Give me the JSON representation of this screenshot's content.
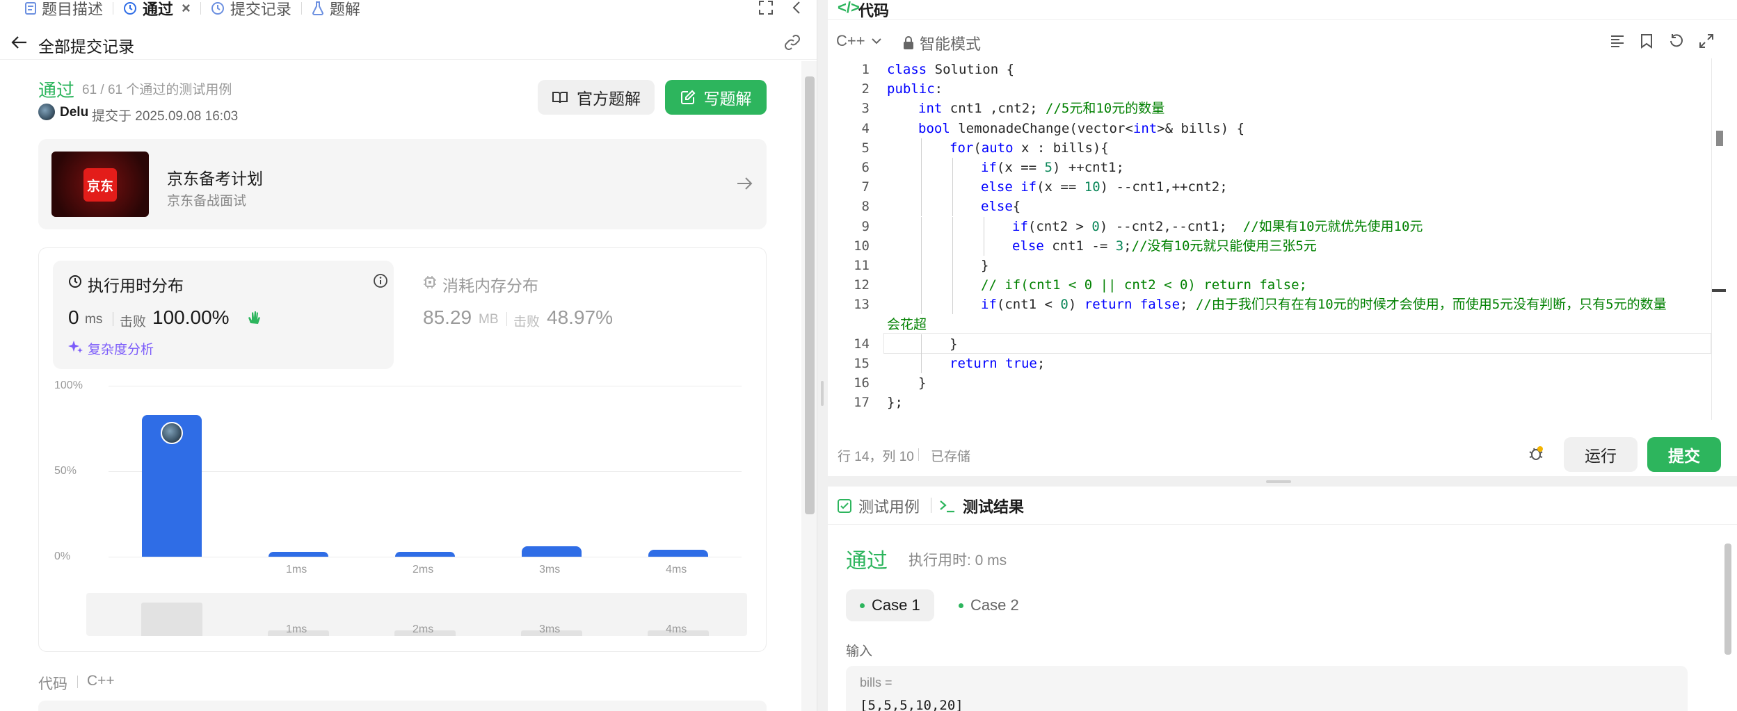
{
  "tabs": [
    {
      "label": "题目描述",
      "icon": "description-icon"
    },
    {
      "label": "通过",
      "icon": "history-icon"
    },
    {
      "label": "提交记录",
      "icon": "history-icon"
    },
    {
      "label": "题解",
      "icon": "flask-icon"
    }
  ],
  "back_label": "全部提交记录",
  "submission": {
    "status": "通过",
    "passed_text": "61 / 61 个通过的测试用例",
    "user": "Delu",
    "submitted_at": "提交于 2025.09.08 16:03",
    "official_solution": "官方题解",
    "write_solution": "写题解"
  },
  "promo": {
    "logo_text": "京东",
    "title": "京东备考计划",
    "subtitle": "京东备战面试"
  },
  "runtime": {
    "title": "执行用时分布",
    "value": "0",
    "unit": "ms",
    "beats_label": "击败",
    "beats": "100.00%",
    "complexity": "复杂度分析"
  },
  "memory": {
    "title": "消耗内存分布",
    "value": "85.29",
    "unit": "MB",
    "beats_label": "击败",
    "beats": "48.97%"
  },
  "chart_data": {
    "type": "bar",
    "categories": [
      "0ms",
      "1ms",
      "2ms",
      "3ms",
      "4ms"
    ],
    "x_tick_labels": [
      "",
      "1ms",
      "2ms",
      "3ms",
      "4ms"
    ],
    "values": [
      83,
      3,
      3,
      6,
      4
    ],
    "ylim": [
      0,
      100
    ],
    "y_ticks": [
      "100%",
      "50%",
      "0%"
    ],
    "grid": true
  },
  "code_section": {
    "label": "代码",
    "lang": "C++"
  },
  "editor": {
    "title": "代码",
    "lang": "C++",
    "mode": "智能模式",
    "lines": [
      {
        "n": "1",
        "indent": 0,
        "html": "<span class='kw'>class</span> Solution {"
      },
      {
        "n": "2",
        "indent": 0,
        "html": "<span class='kw'>public</span>:"
      },
      {
        "n": "3",
        "indent": 1,
        "html": "<span class='ty'>int</span> cnt1 ,cnt2; <span class='cm'>//5元和10元的数量</span>"
      },
      {
        "n": "4",
        "indent": 1,
        "html": "<span class='ty'>bool</span> lemonadeChange(vector&lt;<span class='ty'>int</span>&gt;&amp; bills) {"
      },
      {
        "n": "5",
        "indent": 2,
        "html": "<span class='kw'>for</span>(<span class='kw'>auto</span> x : bills){"
      },
      {
        "n": "6",
        "indent": 3,
        "html": "<span class='kw'>if</span>(x == <span class='nm'>5</span>) ++cnt1;"
      },
      {
        "n": "7",
        "indent": 3,
        "html": "<span class='kw'>else</span> <span class='kw'>if</span>(x == <span class='nm'>10</span>) --cnt1,++cnt2;"
      },
      {
        "n": "8",
        "indent": 3,
        "html": "<span class='kw'>else</span>{"
      },
      {
        "n": "9",
        "indent": 4,
        "html": "<span class='kw'>if</span>(cnt2 &gt; <span class='nm'>0</span>) --cnt2,--cnt1;  <span class='cm'>//如果有10元就优先使用10元</span>"
      },
      {
        "n": "10",
        "indent": 4,
        "html": "<span class='kw'>else</span> cnt1 -= <span class='nm'>3</span>;<span class='cm'>//没有10元就只能使用三张5元</span>"
      },
      {
        "n": "11",
        "indent": 3,
        "html": "}"
      },
      {
        "n": "12",
        "indent": 3,
        "html": "<span class='cm'>// if(cnt1 &lt; 0 || cnt2 &lt; 0) return false;</span>"
      },
      {
        "n": "13",
        "indent": 3,
        "html": "<span class='kw'>if</span>(cnt1 &lt; <span class='nm'>0</span>) <span class='kw'>return</span> <span class='kw'>false</span>; <span class='cm'>//由于我们只有在有10元的时候才会使用，而使用5元没有判断，只有5元的数量</span>"
      },
      {
        "n": "",
        "indent": 0,
        "html": "<span class='cm'>会花超</span>"
      },
      {
        "n": "14",
        "indent": 2,
        "html": "}"
      },
      {
        "n": "15",
        "indent": 2,
        "html": "<span class='kw'>return</span> <span class='kw'>true</span>;"
      },
      {
        "n": "16",
        "indent": 1,
        "html": "}"
      },
      {
        "n": "17",
        "indent": 0,
        "html": "};"
      }
    ],
    "cursor_pos": "行 14，列 10",
    "saved": "已存储",
    "run": "运行",
    "submit": "提交"
  },
  "testpanel": {
    "tab_cases": "测试用例",
    "tab_result": "测试结果",
    "status": "通过",
    "runtime": "执行用时: 0 ms",
    "cases": [
      "Case 1",
      "Case 2"
    ],
    "input_label": "输入",
    "var_name": "bills =",
    "var_value": "[5,5,5,10,20]"
  },
  "colors": {
    "green": "#2db55d",
    "blue": "#2f6de6",
    "accent_purple": "#7c5cfa"
  }
}
